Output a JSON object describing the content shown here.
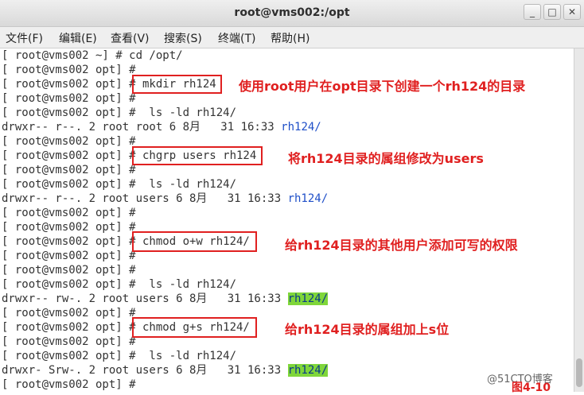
{
  "window": {
    "title": "root@vms002:/opt",
    "btn_minimize": "_",
    "btn_maximize": "□",
    "btn_close": "✕"
  },
  "menu": [
    "文件(F)",
    "编辑(E)",
    "查看(V)",
    "搜索(S)",
    "终端(T)",
    "帮助(H)"
  ],
  "terminal": {
    "lines": [
      "[ root@vms002 ~] # cd /opt/",
      "[ root@vms002 opt] #",
      "[ root@vms002 opt] # mkdir rh124",
      "[ root@vms002 opt] #",
      "[ root@vms002 opt] #  ls -ld rh124/",
      "drwxr-- r--. 2 root root 6 8月   31 16:33 ",
      "[ root@vms002 opt] #",
      "[ root@vms002 opt] # chgrp users rh124",
      "[ root@vms002 opt] #",
      "[ root@vms002 opt] #  ls -ld rh124/",
      "drwxr-- r--. 2 root users 6 8月   31 16:33 ",
      "[ root@vms002 opt] #",
      "[ root@vms002 opt] #",
      "[ root@vms002 opt] # chmod o+w rh124/",
      "[ root@vms002 opt] #",
      "[ root@vms002 opt] #",
      "[ root@vms002 opt] #  ls -ld rh124/",
      "drwxr-- rw-. 2 root users 6 8月   31 16:33 ",
      "[ root@vms002 opt] #",
      "[ root@vms002 opt] # chmod g+s rh124/",
      "[ root@vms002 opt] #",
      "[ root@vms002 opt] #  ls -ld rh124/",
      "drwxr- Srw-. 2 root users 6 8月   31 16:33 ",
      "[ root@vms002 opt] #"
    ],
    "dir_name": "rh124/"
  },
  "annotations": [
    "使用root用户在opt目录下创建一个rh124的目录",
    "将rh124目录的属组修改为users",
    "给rh124目录的其他用户添加可写的权限",
    "给rh124目录的属组加上s位"
  ],
  "watermark": "@51CTO博客",
  "figure_label": "图4-10",
  "colors": {
    "annotation": "#e02020",
    "dir_blue": "#1f4fc8",
    "dir_highlight": "#7fd63a"
  }
}
